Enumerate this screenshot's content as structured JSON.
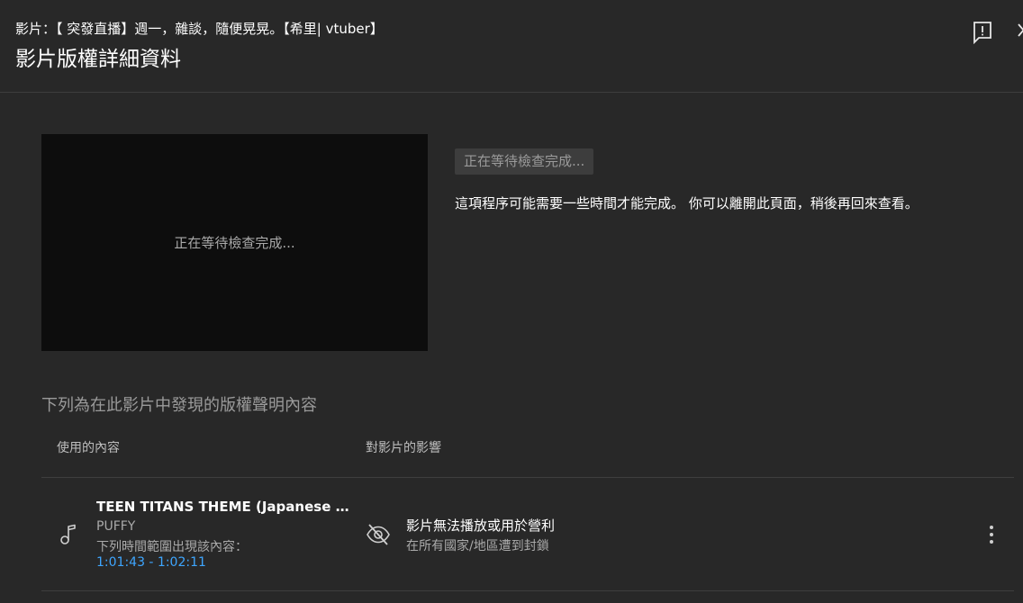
{
  "header": {
    "subtitle": "影片：【 突發直播】週一，雜談，隨便晃晃。【希里| vtuber】",
    "title": "影片版權詳細資料",
    "feedback_icon": "report-feedback-icon",
    "close_icon": "close-icon"
  },
  "preview": {
    "status_text": "正在等待檢查完成..."
  },
  "status": {
    "chip_label": "正在等待檢查完成...",
    "description": "這項程序可能需要一些時間才能完成。 你可以離開此頁面，稍後再回來查看。"
  },
  "claims": {
    "section_title": "下列為在此影片中發現的版權聲明內容",
    "columns": {
      "content": "使用的內容",
      "impact": "對影片的影響"
    },
    "rows": [
      {
        "icon": "music-note-icon",
        "title": "TEEN TITANS THEME (Japanese version)",
        "artist": "PUFFY",
        "range_label": "下列時間範圍出現該內容：",
        "range": "1:01:43 - 1:02:11",
        "impact_icon": "eye-off-icon",
        "impact_title": "影片無法播放或用於營利",
        "impact_sub": "在所有國家/地區遭到封鎖",
        "menu_icon": "more-vert-icon"
      }
    ]
  },
  "colors": {
    "background": "#282828",
    "preview_bg": "#0d0d0d",
    "link": "#3ea6ff",
    "secondary_text": "#aaaaaa",
    "divider": "#3e3e3e"
  }
}
